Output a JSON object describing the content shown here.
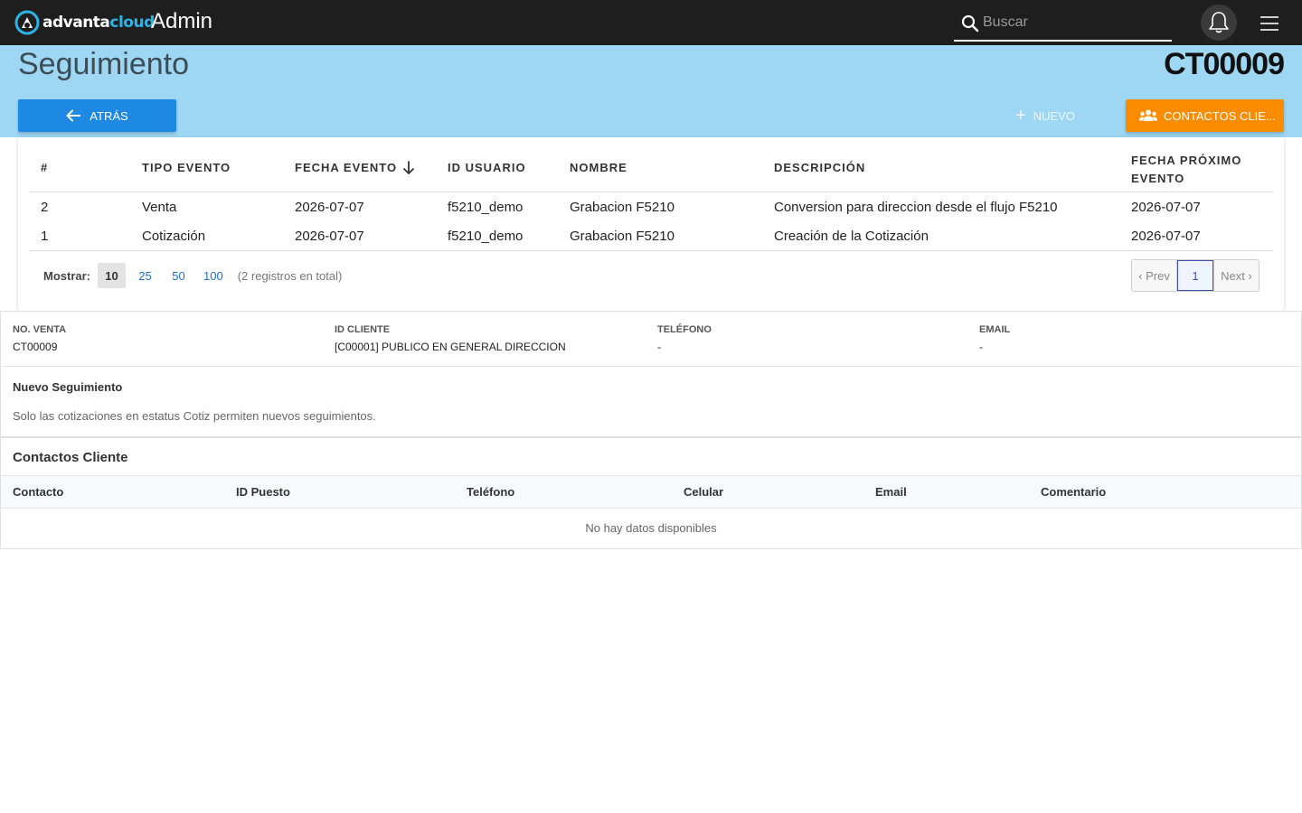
{
  "topbar": {
    "brand_part1": "advanta",
    "brand_part2": "cloud",
    "app_title": "Admin",
    "search_placeholder": "Buscar",
    "icons": {
      "logo": "advantacloud-logo",
      "search": "search-icon",
      "bell": "bell-icon",
      "menu": "hamburger-menu-icon"
    }
  },
  "header": {
    "title": "Seguimiento",
    "record_id": "CT00009",
    "back_label": "ATRÁS",
    "new_label": "NUEVO",
    "contacts_label": "CONTACTOS CLIE...",
    "colors": {
      "band": "#9dd7f3",
      "back_button": "#1e88e5",
      "contacts_button": "#fb8c00"
    }
  },
  "events_table": {
    "columns": [
      "#",
      "TIPO EVENTO",
      "FECHA EVENTO",
      "ID USUARIO",
      "NOMBRE",
      "DESCRIPCIÓN",
      "FECHA PRÓXIMO",
      "EVENTO"
    ],
    "sort_icon": "arrow-down-icon",
    "rows": [
      {
        "num": "2",
        "tipo": "Venta",
        "fecha": "2026-07-07",
        "usuario": "f5210_demo",
        "nombre": "Grabacion F5210",
        "descripcion": "Conversion para direccion desde el flujo F5210",
        "proximo": "2026-07-07"
      },
      {
        "num": "1",
        "tipo": "Cotización",
        "fecha": "2026-07-07",
        "usuario": "f5210_demo",
        "nombre": "Grabacion F5210",
        "descripcion": "Creación de la Cotización",
        "proximo": "2026-07-07"
      }
    ],
    "pager": {
      "show_label": "Mostrar:",
      "options": [
        "10",
        "25",
        "50",
        "100"
      ],
      "selected": "10",
      "total_text": "(2 registros en total)",
      "prev": "‹ Prev",
      "current_page": "1",
      "next": "Next ›"
    }
  },
  "info": {
    "no_venta_label": "NO. VENTA",
    "no_venta": "CT00009",
    "cliente_label": "ID CLIENTE",
    "cliente": "[C00001] PUBLICO EN GENERAL DIRECCION",
    "telefono_label": "TELÉFONO",
    "telefono": "-",
    "email_label": "EMAIL",
    "email": "-"
  },
  "nuevo": {
    "title": "Nuevo Seguimiento",
    "message": "Solo las cotizaciones en estatus Cotiz permiten nuevos seguimientos."
  },
  "contactos": {
    "title": "Contactos Cliente",
    "columns": [
      "Contacto",
      "ID Puesto",
      "Teléfono",
      "Celular",
      "Email",
      "Comentario"
    ],
    "empty": "No hay datos disponibles"
  }
}
